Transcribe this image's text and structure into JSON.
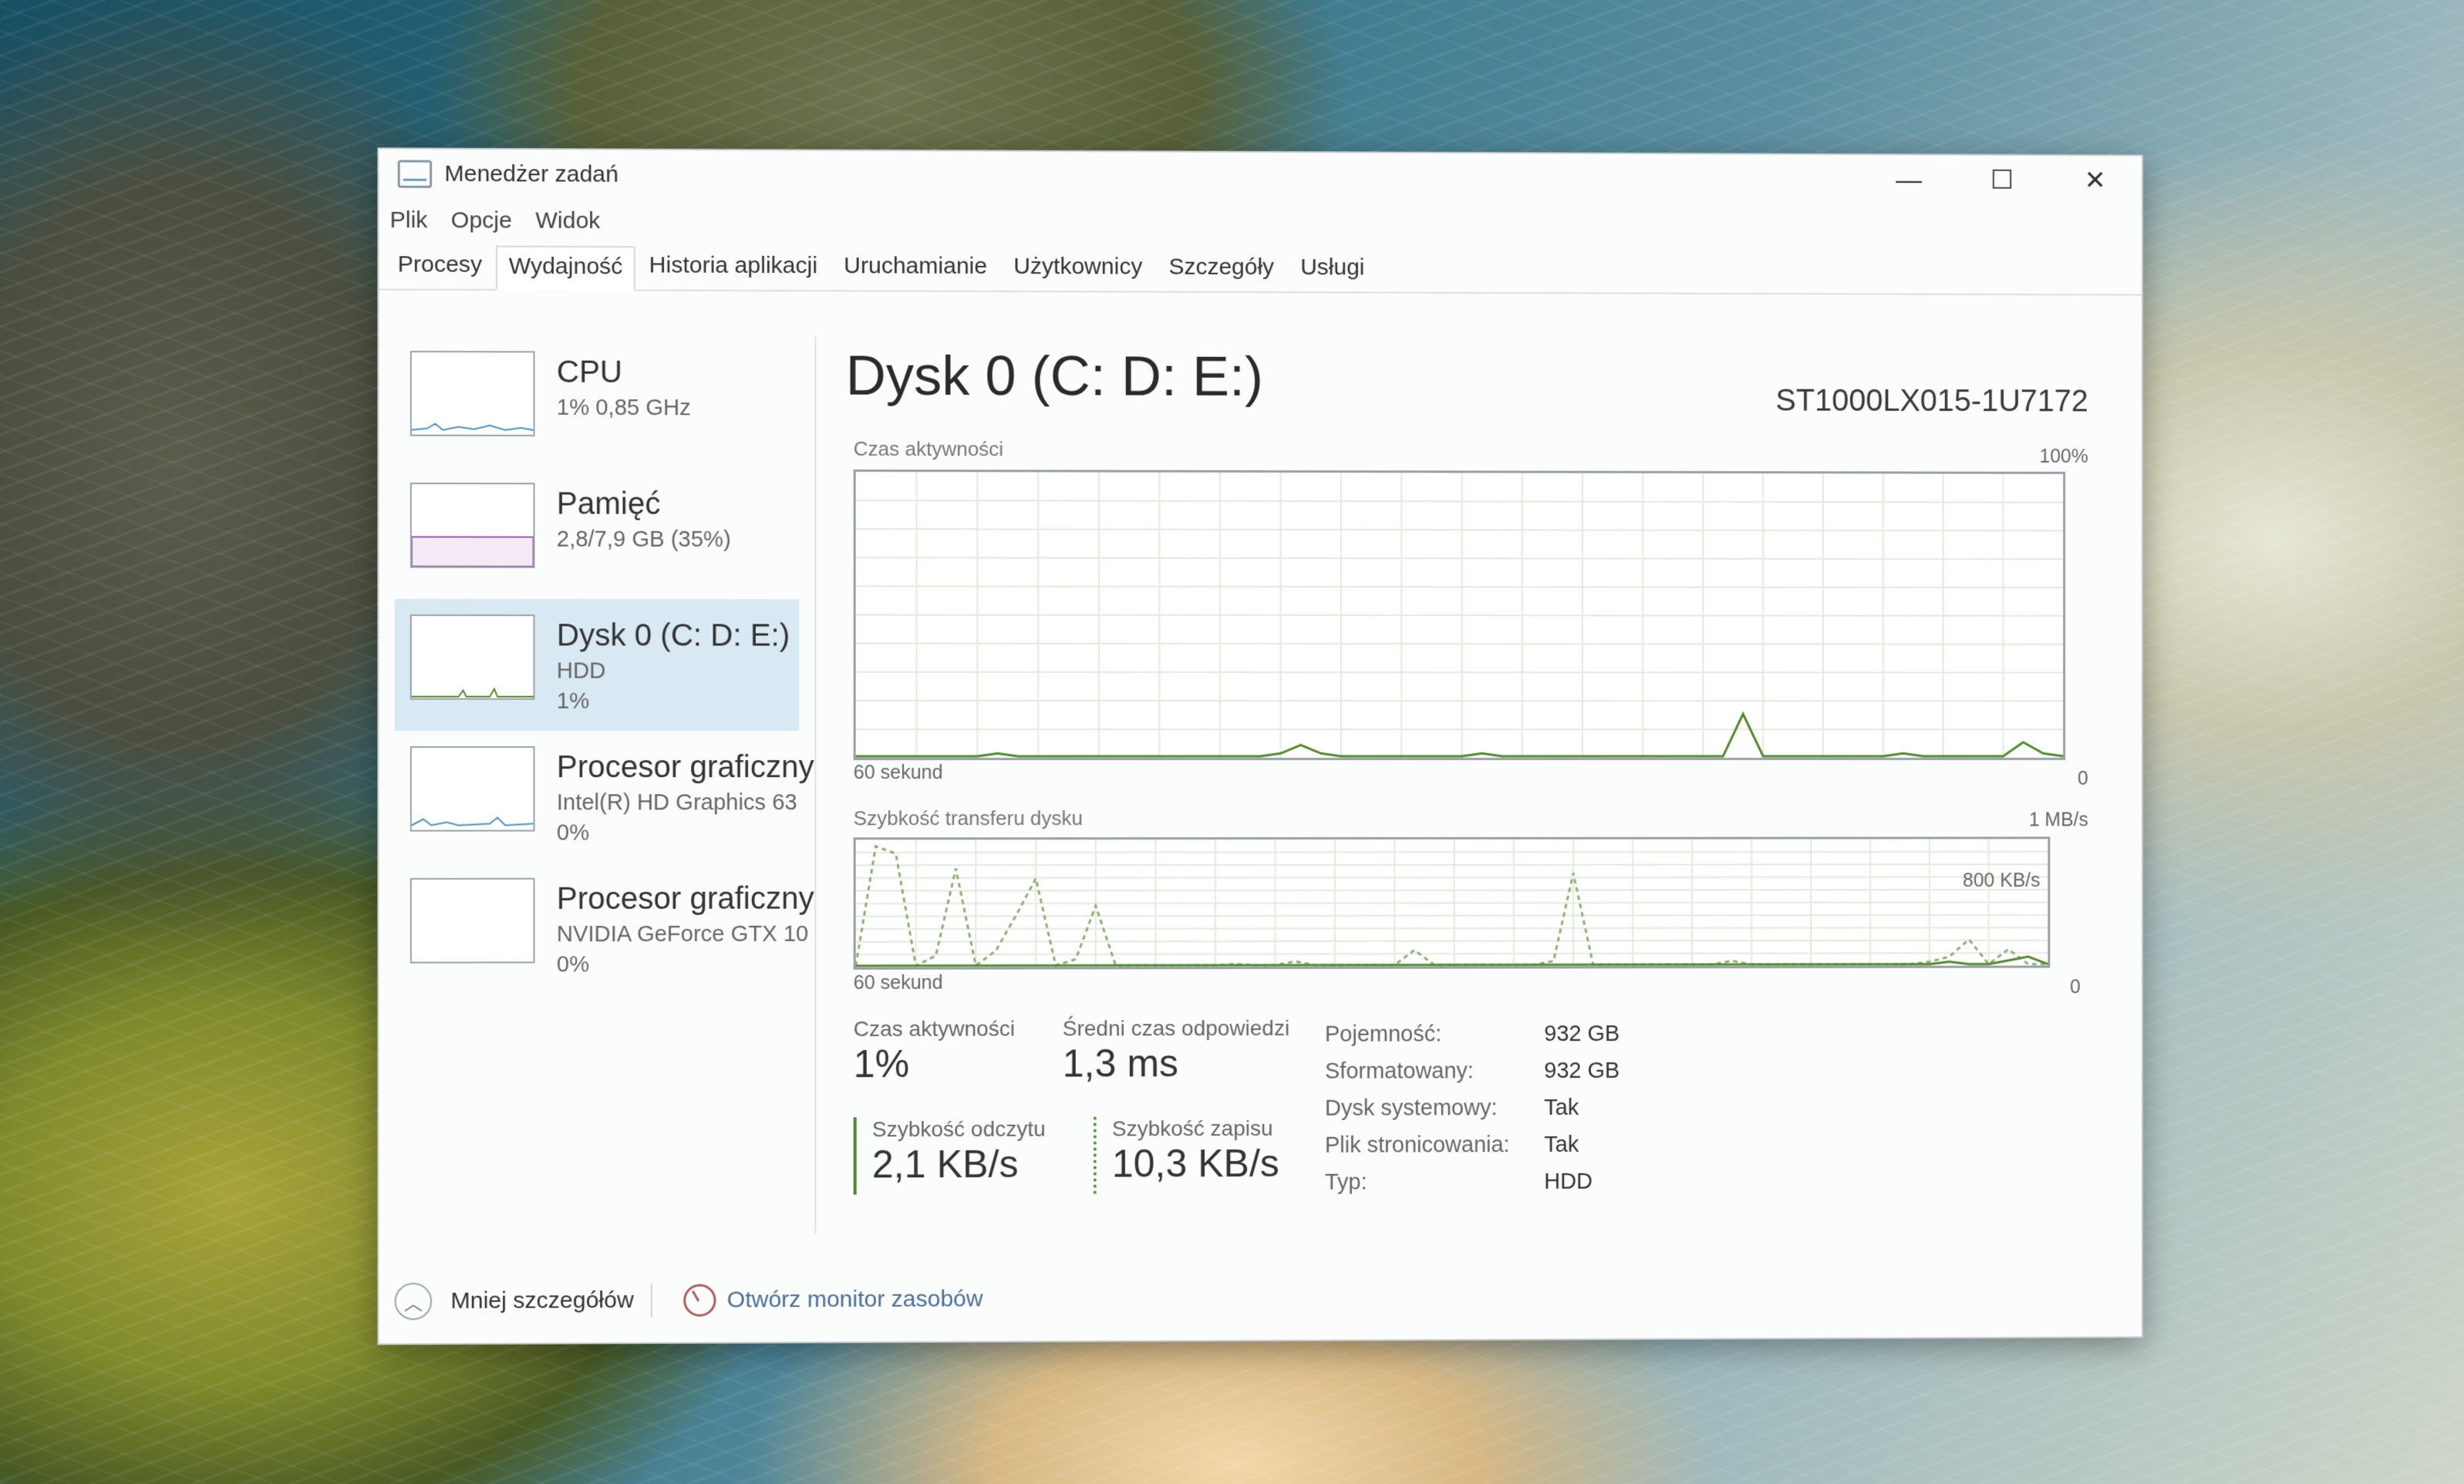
{
  "window": {
    "title": "Menedżer zadań",
    "buttons": {
      "minimize": "—",
      "maximize": "☐",
      "close": "✕"
    }
  },
  "menu": [
    "Plik",
    "Opcje",
    "Widok"
  ],
  "tabs": [
    {
      "label": "Procesy",
      "active": false
    },
    {
      "label": "Wydajność",
      "active": true
    },
    {
      "label": "Historia aplikacji",
      "active": false
    },
    {
      "label": "Uruchamianie",
      "active": false
    },
    {
      "label": "Użytkownicy",
      "active": false
    },
    {
      "label": "Szczegóły",
      "active": false
    },
    {
      "label": "Usługi",
      "active": false
    }
  ],
  "sidebar": [
    {
      "title": "CPU",
      "lines": [
        "1% 0,85 GHz"
      ]
    },
    {
      "title": "Pamięć",
      "lines": [
        "2,8/7,9 GB (35%)"
      ]
    },
    {
      "title": "Dysk 0 (C: D: E:)",
      "lines": [
        "HDD",
        "1%"
      ]
    },
    {
      "title": "Procesor graficzny",
      "lines": [
        "Intel(R) HD Graphics 63",
        "0%"
      ]
    },
    {
      "title": "Procesor graficzny",
      "lines": [
        "NVIDIA GeForce GTX 10",
        "0%"
      ]
    }
  ],
  "main": {
    "title": "Dysk 0 (C: D: E:)",
    "model": "ST1000LX015-1U7172",
    "activity_chart": {
      "label": "Czas aktywności",
      "max_label": "100%",
      "x_left": "60 sekund",
      "x_right": "0"
    },
    "transfer_chart": {
      "label": "Szybkość transferu dysku",
      "max_label": "1 MB/s",
      "mid_label": "800 KB/s",
      "x_left": "60 sekund",
      "x_right": "0"
    },
    "stats": {
      "activity_label": "Czas aktywności",
      "activity_value": "1%",
      "response_label": "Średni czas odpowiedzi",
      "response_value": "1,3 ms",
      "read_label": "Szybkość odczytu",
      "read_value": "2,1 KB/s",
      "write_label": "Szybkość zapisu",
      "write_value": "10,3 KB/s"
    },
    "properties": [
      {
        "key": "Pojemność:",
        "value": "932 GB"
      },
      {
        "key": "Sformatowany:",
        "value": "932 GB"
      },
      {
        "key": "Dysk systemowy:",
        "value": "Tak"
      },
      {
        "key": "Plik stronicowania:",
        "value": "Tak"
      },
      {
        "key": "Typ:",
        "value": "HDD"
      }
    ]
  },
  "footer": {
    "fewer_details": "Mniej szczegółów",
    "open_monitor": "Otwórz monitor zasobów"
  },
  "chart_data": [
    {
      "type": "line",
      "title": "Czas aktywności",
      "ylim": [
        0,
        100
      ],
      "xlabel": "60 sekund",
      "series": [
        {
          "values": [
            0,
            0,
            0,
            0,
            0,
            0,
            0,
            1,
            0,
            0,
            0,
            0,
            0,
            0,
            0,
            0,
            0,
            0,
            0,
            0,
            0,
            1,
            4,
            1,
            0,
            0,
            0,
            0,
            0,
            0,
            0,
            1,
            0,
            0,
            0,
            0,
            0,
            0,
            0,
            0,
            0,
            0,
            0,
            0,
            15,
            0,
            0,
            0,
            0,
            0,
            0,
            0,
            1,
            0,
            0,
            0,
            0,
            0,
            5,
            1,
            0
          ]
        }
      ]
    },
    {
      "type": "line",
      "title": "Szybkość transferu dysku",
      "ylim": [
        0,
        1000
      ],
      "xlabel": "60 sekund",
      "series": [
        {
          "values": [
            0,
            960,
            900,
            0,
            80,
            780,
            0,
            120,
            400,
            700,
            0,
            50,
            480,
            0,
            0,
            0,
            0,
            0,
            0,
            10,
            0,
            0,
            30,
            0,
            0,
            0,
            0,
            0,
            120,
            0,
            0,
            0,
            0,
            0,
            0,
            30,
            740,
            0,
            0,
            0,
            0,
            0,
            0,
            0,
            30,
            0,
            0,
            0,
            0,
            0,
            0,
            0,
            0,
            0,
            20,
            60,
            200,
            0,
            120,
            0,
            0
          ]
        },
        {
          "values": [
            0,
            0,
            0,
            0,
            0,
            0,
            0,
            0,
            0,
            0,
            0,
            0,
            0,
            0,
            0,
            0,
            0,
            0,
            0,
            0,
            0,
            0,
            0,
            0,
            0,
            0,
            0,
            0,
            0,
            0,
            0,
            0,
            0,
            0,
            0,
            0,
            0,
            0,
            0,
            0,
            0,
            0,
            0,
            0,
            0,
            0,
            0,
            0,
            0,
            0,
            0,
            0,
            0,
            0,
            0,
            20,
            0,
            0,
            30,
            60,
            0
          ]
        }
      ]
    }
  ]
}
